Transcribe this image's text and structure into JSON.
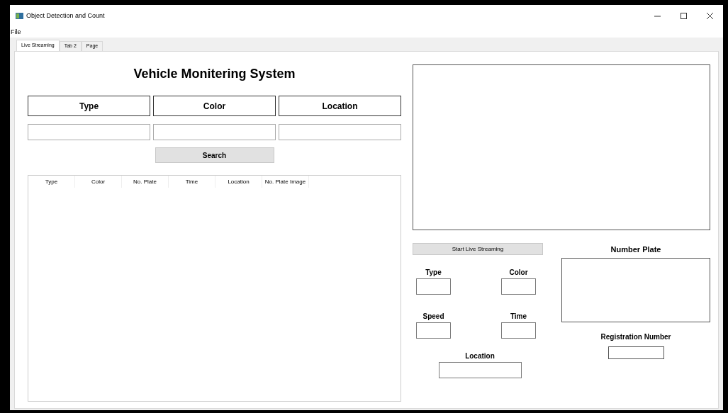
{
  "window": {
    "title": "Object Detection and Count"
  },
  "menu": [
    "File"
  ],
  "tabs": [
    {
      "label": "Live Streaming",
      "selected": true
    },
    {
      "label": "Tab 2",
      "selected": false
    },
    {
      "label": "Page",
      "selected": false
    }
  ],
  "heading": "Vehicle Monitering System",
  "filters": [
    {
      "label": "Type"
    },
    {
      "label": "Color"
    },
    {
      "label": "Location"
    }
  ],
  "search_button": "Search",
  "table": {
    "columns": [
      "Type",
      "Color",
      "No. Plate",
      "Time",
      "Location",
      "No. Plate Image"
    ]
  },
  "stream_button": "Start Live Streaming",
  "details": [
    {
      "label": "Type"
    },
    {
      "label": "Color"
    },
    {
      "label": "Speed"
    },
    {
      "label": "Time"
    },
    {
      "label": "Location"
    }
  ],
  "number_plate": {
    "label": "Number Plate"
  },
  "registration": {
    "label": "Registration Number"
  }
}
